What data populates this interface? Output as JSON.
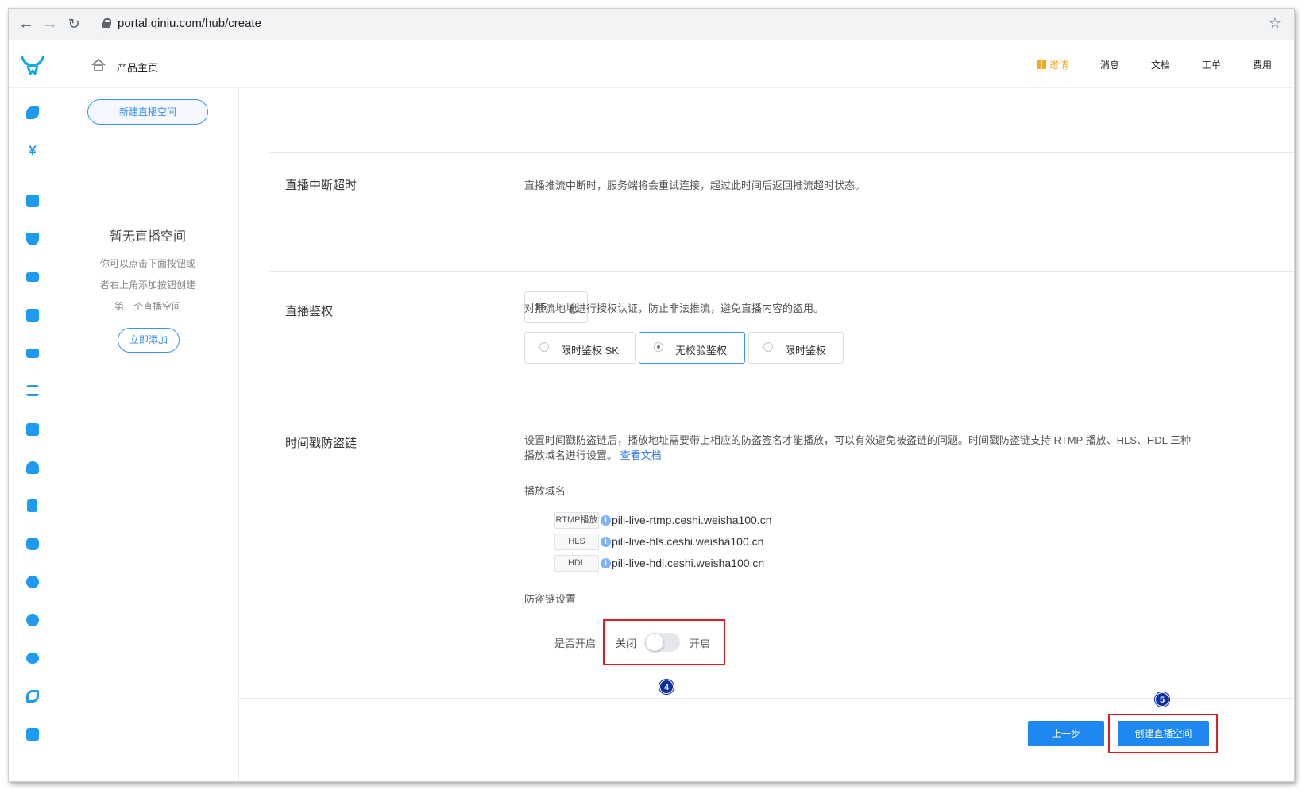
{
  "browser": {
    "url": "portal.qiniu.com/hub/create",
    "back_icon": "back-arrow-icon",
    "forward_icon": "forward-arrow-icon",
    "reload_icon": "reload-icon",
    "bookmark_icon": "star-icon"
  },
  "header": {
    "home_label": "产品主页",
    "nav": [
      {
        "label": "邀请",
        "accent": "#f5a623",
        "icon": "gift-icon"
      },
      {
        "label": "消息"
      },
      {
        "label": "文档"
      },
      {
        "label": "工单"
      },
      {
        "label": "费用"
      }
    ]
  },
  "sidebar": {
    "new_space_button": "新建直播空间",
    "empty_title": "暂无直播空间",
    "empty_lines": [
      "你可以点击下面按钮或",
      "者右上角添加按钮创建",
      "第一个直播空间"
    ],
    "add_now_button": "立即添加"
  },
  "sections": {
    "timeout": {
      "label": "直播中断超时",
      "description": "直播推流中断时，服务端将会重试连接，超过此时间后返回推流超时状态。",
      "value": "15",
      "unit": "秒"
    },
    "auth": {
      "label": "直播鉴权",
      "description": "对推流地址进行授权认证，防止非法推流，避免直播内容的盗用。",
      "options": [
        {
          "label": "限时鉴权 SK",
          "selected": false
        },
        {
          "label": "无校验鉴权",
          "selected": true
        },
        {
          "label": "限时鉴权",
          "selected": false
        }
      ]
    },
    "antileech": {
      "label": "时间戳防盗链",
      "description": "设置时间戳防盗链后，播放地址需要带上相应的防盗签名才能播放，可以有效避免被盗链的问题。时间戳防盗链支持 RTMP 播放、HLS、HDL 三种播放域名进行设置。",
      "doc_link": "查看文档",
      "domains_label": "播放域名",
      "domains": [
        {
          "tag": "RTMP播放",
          "host": "pili-live-rtmp.ceshi.weisha100.cn"
        },
        {
          "tag": "HLS",
          "host": "pili-live-hls.ceshi.weisha100.cn"
        },
        {
          "tag": "HDL",
          "host": "pili-live-hdl.ceshi.weisha100.cn"
        }
      ],
      "settings_label": "防盗链设置",
      "enable_label": "是否开启",
      "off_label": "关闭",
      "on_label": "开启",
      "enabled": false
    }
  },
  "annotations": {
    "step4": "4",
    "step5": "5",
    "highlight_color": "#e01b24"
  },
  "footer": {
    "prev_button": "上一步",
    "create_button": "创建直播空间"
  },
  "colors": {
    "primary": "#1e88f0",
    "link": "#2f7cf6",
    "icon": "#1e9bf0"
  }
}
